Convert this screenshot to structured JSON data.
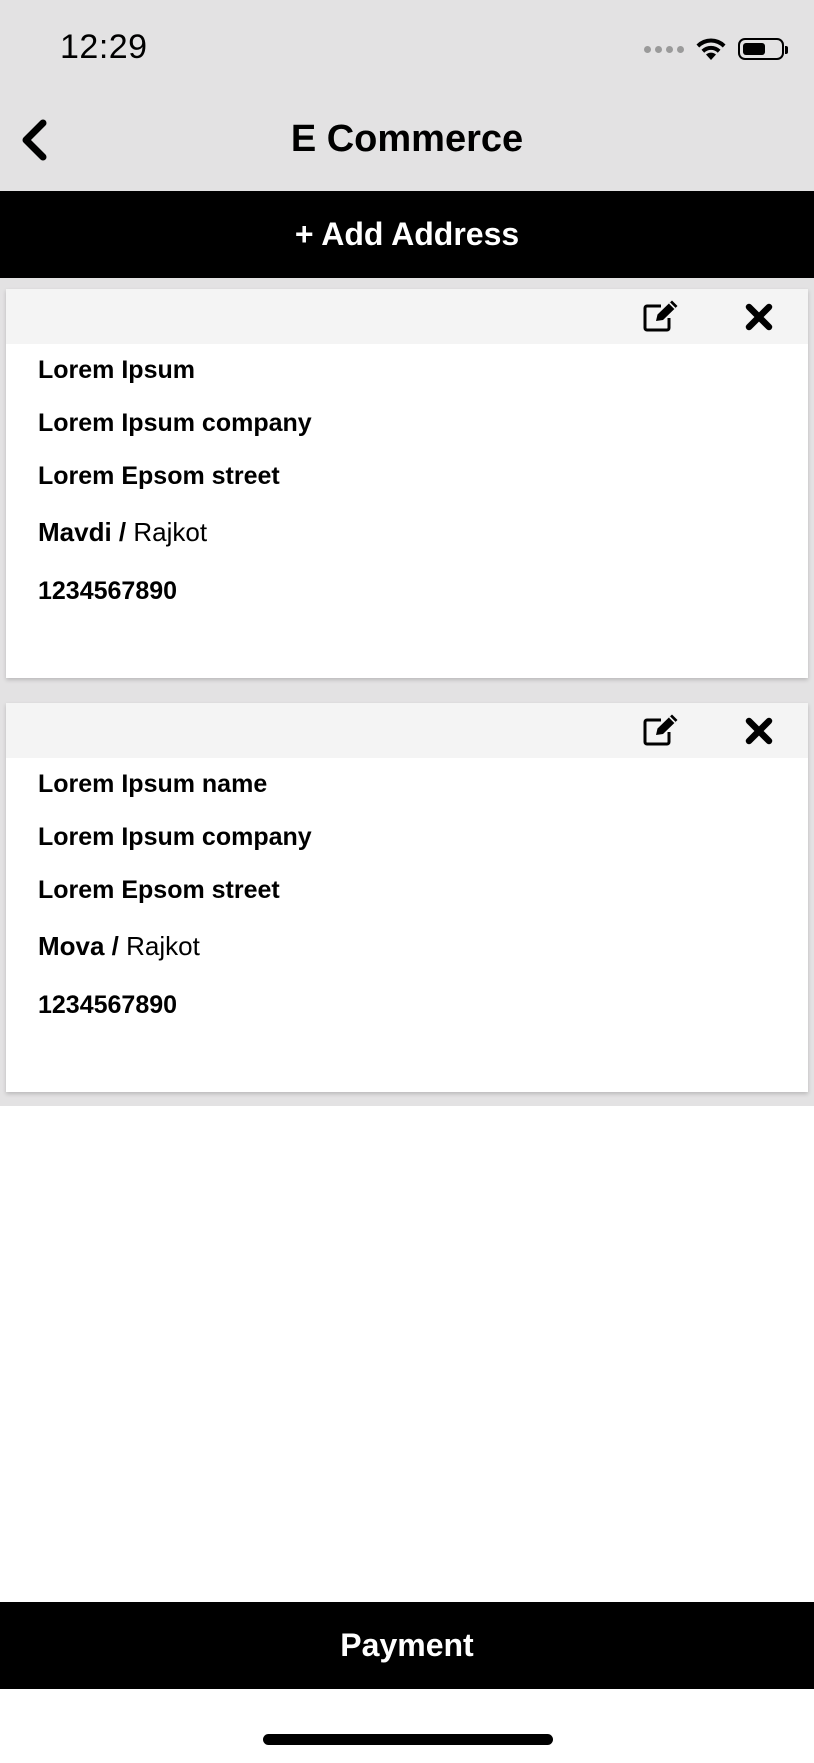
{
  "status": {
    "time": "12:29",
    "icons": [
      "signal-dots-icon",
      "wifi-icon",
      "battery-icon"
    ]
  },
  "header": {
    "back_icon": "chevron-left-icon",
    "title": "E Commerce"
  },
  "add_address_label": "+ Add Address",
  "addresses": [
    {
      "name": "Lorem Ipsum",
      "company": "Lorem Ipsum company",
      "street": "Lorem Epsom street",
      "area": "Mavdi /",
      "city": "Rajkot",
      "phone": "1234567890",
      "edit_icon": "edit-icon",
      "delete_icon": "close-icon"
    },
    {
      "name": "Lorem Ipsum name",
      "company": "Lorem Ipsum company",
      "street": "Lorem Epsom street",
      "area": "Mova /",
      "city": "Rajkot",
      "phone": "1234567890",
      "edit_icon": "edit-icon",
      "delete_icon": "close-icon"
    }
  ],
  "payment_label": "Payment",
  "colors": {
    "header_bg": "#e3e2e3",
    "button_bg": "#000000",
    "button_text": "#ffffff",
    "card_header_bg": "#f4f4f4"
  }
}
